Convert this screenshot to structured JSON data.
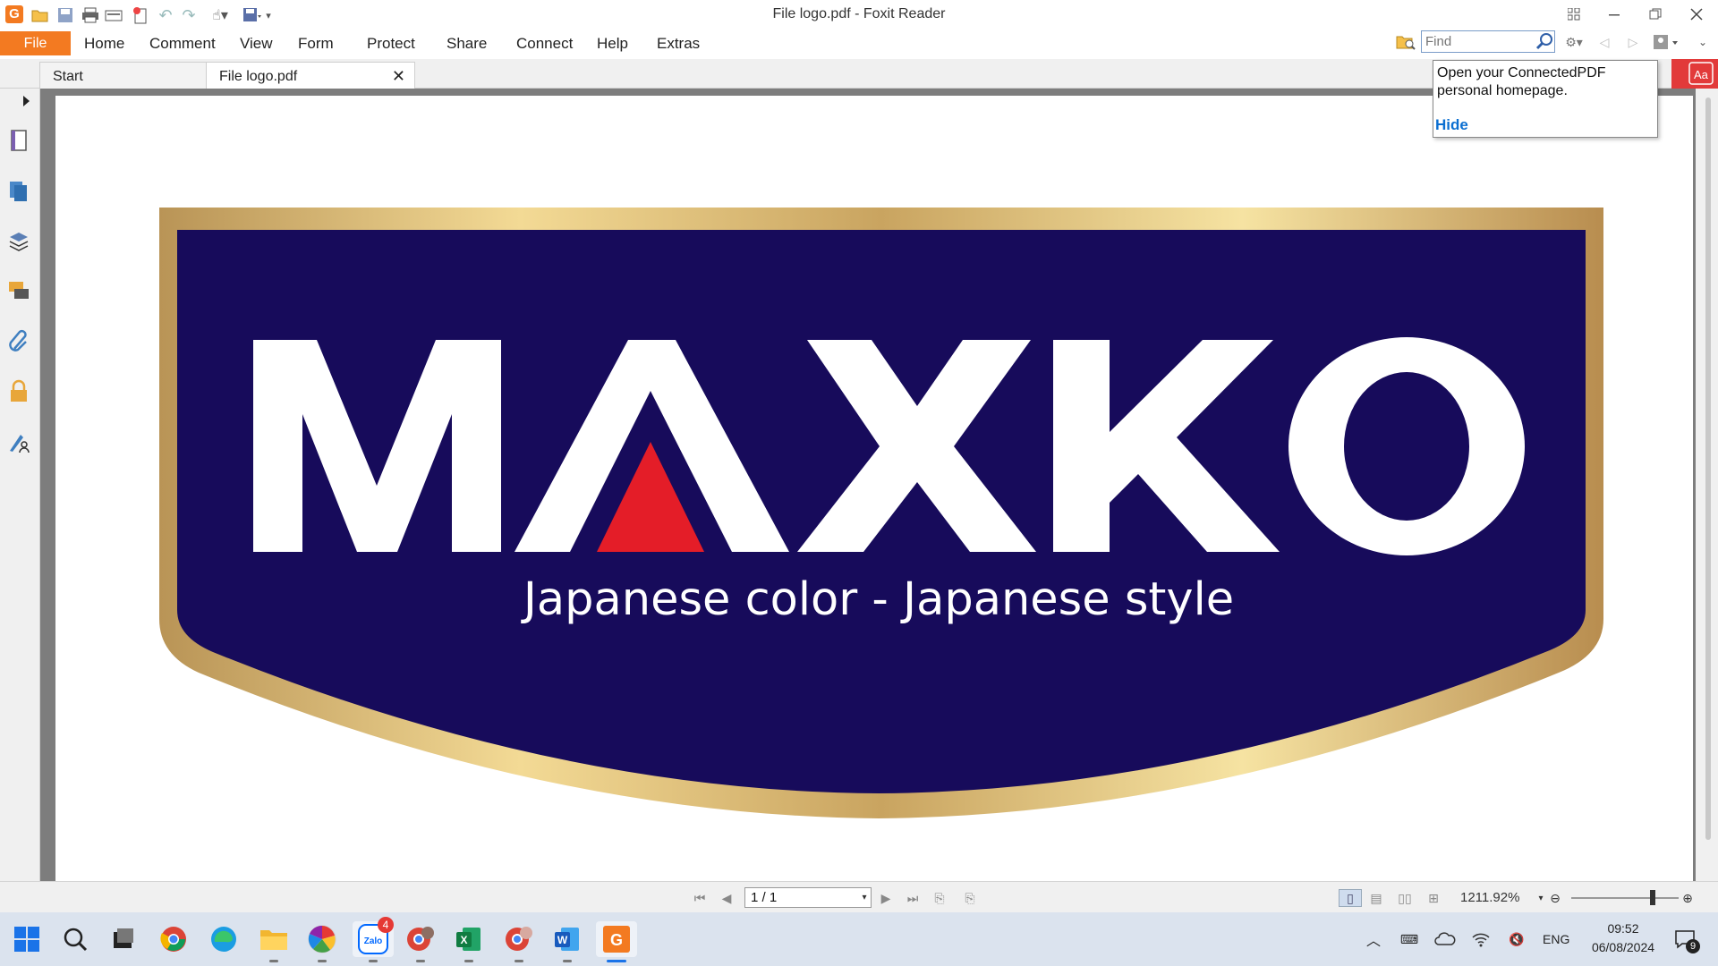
{
  "window": {
    "title": "File logo.pdf - Foxit Reader",
    "app_logo_glyph": "G"
  },
  "quick_access": {
    "icons": [
      "open-folder-icon",
      "save-icon",
      "print-icon",
      "scan-icon",
      "new-file-icon",
      "undo-icon",
      "redo-icon",
      "hand-tool-icon",
      "save-as-icon",
      "customize-dropdown-icon"
    ]
  },
  "menu": {
    "file_label": "File",
    "items": [
      "Home",
      "Comment",
      "View",
      "Form",
      "Protect",
      "Share",
      "Connect",
      "Help",
      "Extras"
    ]
  },
  "search": {
    "placeholder": "Find"
  },
  "tabs": [
    {
      "label": "Start",
      "active": false
    },
    {
      "label": "File logo.pdf",
      "active": true
    }
  ],
  "tab_close_glyph": "✕",
  "tooltip": {
    "text": "Open your ConnectedPDF personal homepage.",
    "hide_label": "Hide"
  },
  "pdf": {
    "brand": "MAXKO",
    "slogan": "Japanese color - Japanese style",
    "colors": {
      "navy": "#170b5b",
      "gold": "#c8a45a",
      "red": "#e41d28",
      "white": "#ffffff"
    }
  },
  "statusbar": {
    "page_value": "1 / 1",
    "zoom_value": "1211.92%"
  },
  "taskbar": {
    "apps": [
      "windows-start-icon",
      "search-icon",
      "task-view-icon",
      "chrome-icon",
      "edge-icon",
      "file-explorer-icon",
      "picasa-icon",
      "zalo-icon",
      "chrome-profile-icon",
      "excel-icon",
      "chrome-profile-2-icon",
      "word-icon",
      "foxit-reader-icon"
    ],
    "zalo_badge": "4",
    "language": "ENG",
    "time": "09:52",
    "date": "06/08/2024",
    "notification_count": "9"
  }
}
